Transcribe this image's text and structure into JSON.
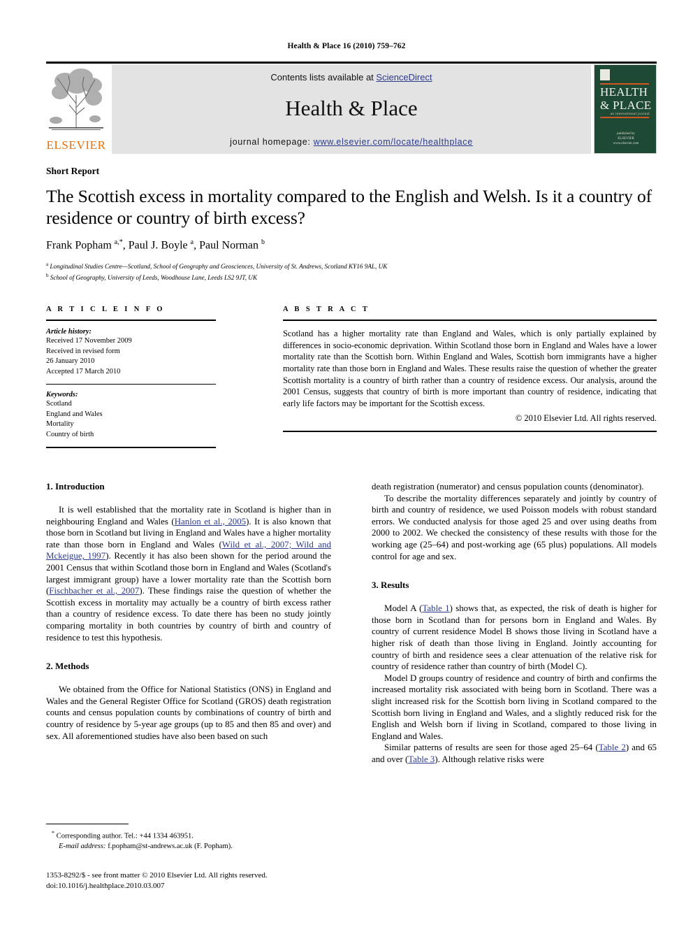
{
  "running_head": "Health & Place 16 (2010) 759–762",
  "masthead": {
    "contents_prefix": "Contents lists available at ",
    "sciencedirect": "ScienceDirect",
    "journal_title": "Health & Place",
    "homepage_prefix": "journal homepage: ",
    "homepage_url": "www.elsevier.com/locate/healthplace",
    "publisher_name": "ELSEVIER",
    "cover": {
      "line1": "HEALTH",
      "line2": "& PLACE",
      "subtitle": "an international journal",
      "footer": "published by\nELSEVIER\nwww.elsevier.com"
    },
    "link_color": "#2c3a8c"
  },
  "article": {
    "doctype": "Short Report",
    "title": "The Scottish excess in mortality compared to the English and Welsh. Is it a country of residence or country of birth excess?",
    "authors_html": "Frank Popham <sup>a,*</sup>, Paul J. Boyle <sup>a</sup>, Paul Norman <sup>b</sup>",
    "affiliations": [
      "Longitudinal Studies Centre—Scotland, School of Geography and Geosciences, University of St. Andrews, Scotland KY16 9AL, UK",
      "School of Geography, University of Leeds, Woodhouse Lane, Leeds LS2 9JT, UK"
    ],
    "affiliation_marks": [
      "a",
      "b"
    ]
  },
  "article_info": {
    "heading": "A R T I C L E  I N F O",
    "history_label": "Article history:",
    "history_lines": [
      "Received 17 November 2009",
      "Received in revised form",
      "26 January 2010",
      "Accepted 17 March 2010"
    ],
    "keywords_label": "Keywords:",
    "keywords": [
      "Scotland",
      "England and Wales",
      "Mortality",
      "Country of birth"
    ]
  },
  "abstract": {
    "heading": "A B S T R A C T",
    "text": "Scotland has a higher mortality rate than England and Wales, which is only partially explained by differences in socio-economic deprivation. Within Scotland those born in England and Wales have a lower mortality rate than the Scottish born. Within England and Wales, Scottish born immigrants have a higher mortality rate than those born in England and Wales. These results raise the question of whether the greater Scottish mortality is a country of birth rather than a country of residence excess. Our analysis, around the 2001 Census, suggests that country of birth is more important than country of residence, indicating that early life factors may be important for the Scottish excess.",
    "copyright": "© 2010 Elsevier Ltd. All rights reserved."
  },
  "sections": {
    "introduction_heading": "1.  Introduction",
    "methods_heading": "2.  Methods",
    "results_heading": "3.  Results"
  },
  "body": {
    "intro_p1_a": "It is well established that the mortality rate in Scotland is higher than in neighbouring England and Wales (",
    "intro_ref1": "Hanlon et al., 2005",
    "intro_p1_b": "). It is also known that those born in Scotland but living in England and Wales have a higher mortality rate than those born in England and Wales (",
    "intro_ref2": "Wild et al., 2007; Wild and Mckeigue, 1997",
    "intro_p1_c": "). Recently it has also been shown for the period around the 2001 Census that within Scotland those born in England and Wales (Scotland's largest immigrant group) have a lower mortality rate than the Scottish born (",
    "intro_ref3": "Fischbacher et al., 2007",
    "intro_p1_d": "). These findings raise the question of whether the Scottish excess in mortality may actually be a country of birth excess rather than a country of residence excess. To date there has been no study jointly comparing mortality in both countries by country of birth and country of residence to test this hypothesis.",
    "methods_p1": "We obtained from the Office for National Statistics (ONS) in England and Wales and the General Register Office for Scotland (GROS) death registration counts and census population counts by combinations of country of birth and country of residence by 5-year age groups (up to 85 and then 85 and over) and sex. All aforementioned studies have also been based on such",
    "methods_p1_cont": "death registration (numerator) and census population counts (denominator).",
    "methods_p2": "To describe the mortality differences separately and jointly by country of birth and country of residence, we used Poisson models with robust standard errors. We conducted analysis for those aged 25 and over using deaths from 2000 to 2002. We checked the consistency of these results with those for the working age (25–64) and post-working age (65 plus) populations. All models control for age and sex.",
    "results_p1_a": "Model A (",
    "results_ref_t1": "Table 1",
    "results_p1_b": ") shows that, as expected, the risk of death is higher for those born in Scotland than for persons born in England and Wales. By country of current residence Model B shows those living in Scotland have a higher risk of death than those living in England. Jointly accounting for country of birth and residence sees a clear attenuation of the relative risk for country of residence rather than country of birth (Model C).",
    "results_p2": "Model D groups country of residence and country of birth and confirms the increased mortality risk associated with being born in Scotland. There was a slight increased risk for the Scottish born living in Scotland compared to the Scottish born living in England and Wales, and a slightly reduced risk for the English and Welsh born if living in Scotland, compared to those living in England and Wales.",
    "results_p3_a": "Similar patterns of results are seen for those aged 25–64 (",
    "results_ref_t2": "Table 2",
    "results_p3_b": ") and 65 and over (",
    "results_ref_t3": "Table 3",
    "results_p3_c": "). Although relative risks were"
  },
  "footnotes": {
    "corresponding": "Corresponding author. Tel.: +44 1334 463951.",
    "email_label": "E-mail address:",
    "email_value": "f.popham@st-andrews.ac.uk (F. Popham).",
    "imprint_line1": "1353-8292/$ - see front matter © 2010 Elsevier Ltd. All rights reserved.",
    "imprint_line2": "doi:10.1016/j.healthplace.2010.03.007"
  }
}
